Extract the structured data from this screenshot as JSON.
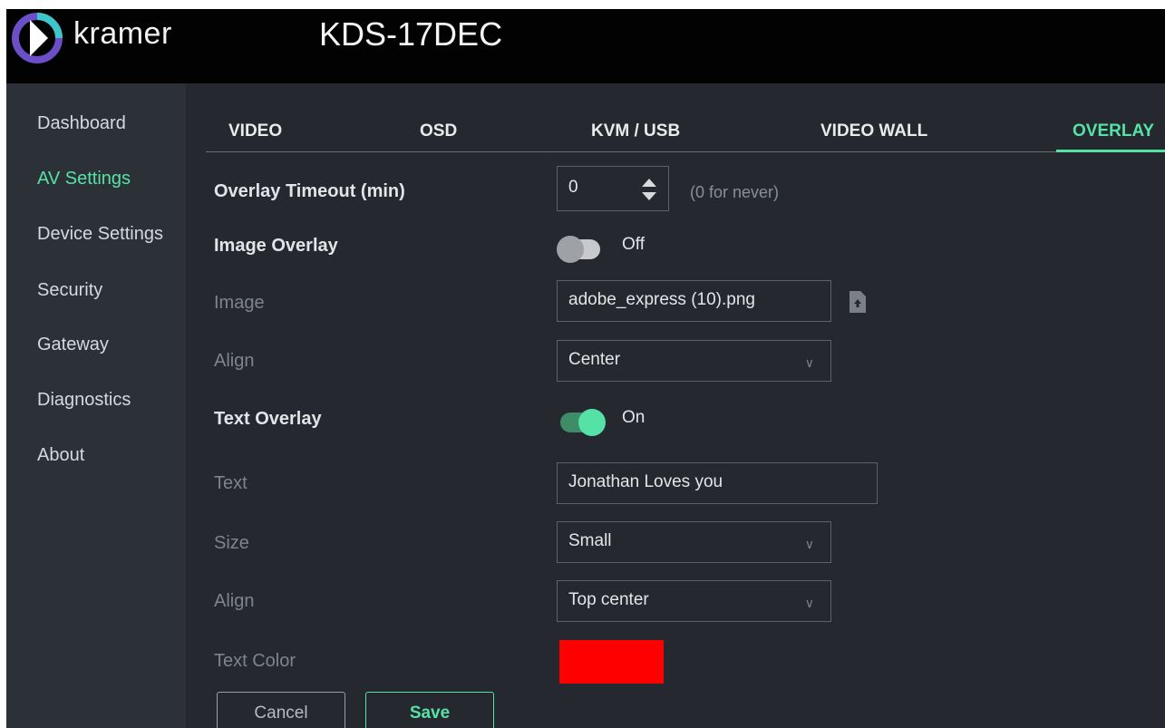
{
  "header": {
    "brand": "kramer",
    "device_name": "KDS-17DEC"
  },
  "sidebar": {
    "items": [
      {
        "label": "Dashboard",
        "active": false
      },
      {
        "label": "AV Settings",
        "active": true
      },
      {
        "label": "Device Settings",
        "active": false
      },
      {
        "label": "Security",
        "active": false
      },
      {
        "label": "Gateway",
        "active": false
      },
      {
        "label": "Diagnostics",
        "active": false
      },
      {
        "label": "About",
        "active": false
      }
    ]
  },
  "tabs": [
    {
      "label": "VIDEO",
      "active": false
    },
    {
      "label": "OSD",
      "active": false
    },
    {
      "label": "KVM / USB",
      "active": false
    },
    {
      "label": "VIDEO WALL",
      "active": false
    },
    {
      "label": "OVERLAY",
      "active": true
    }
  ],
  "overlay": {
    "timeout": {
      "label": "Overlay Timeout (min)",
      "value": "0",
      "hint": "(0 for never)"
    },
    "image_overlay": {
      "label": "Image Overlay",
      "state": "Off"
    },
    "image": {
      "label": "Image",
      "value": "adobe_express (10).png",
      "icon": "file-upload-icon"
    },
    "image_align": {
      "label": "Align",
      "value": "Center"
    },
    "text_overlay": {
      "label": "Text Overlay",
      "state": "On"
    },
    "text": {
      "label": "Text",
      "value": "Jonathan Loves you"
    },
    "size": {
      "label": "Size",
      "value": "Small"
    },
    "text_align": {
      "label": "Align",
      "value": "Top center"
    },
    "text_color": {
      "label": "Text Color",
      "value": "#ff0000"
    }
  },
  "buttons": {
    "cancel": "Cancel",
    "save": "Save"
  },
  "colors": {
    "accent": "#56e2a6",
    "header_bg": "#020202",
    "panel_bg": "#25292f",
    "sidebar_bg": "#2c3138"
  }
}
